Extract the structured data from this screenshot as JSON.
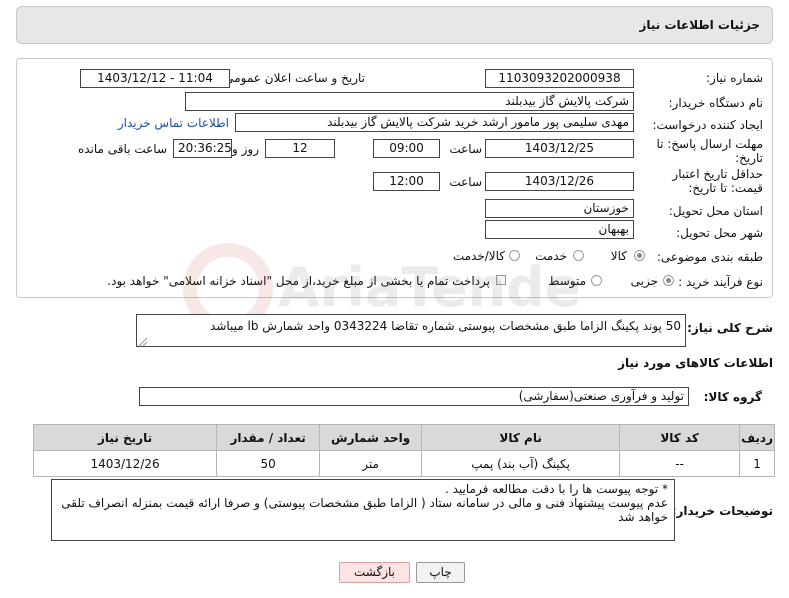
{
  "header": {
    "title": "جزئیات اطلاعات نیاز"
  },
  "form": {
    "need_number_label": "شماره نیاز:",
    "need_number": "1103093202000938",
    "announce_label": "تاریخ و ساعت اعلان عمومی:",
    "announce_value": "1403/12/12 - 11:04",
    "buyer_label": "نام دستگاه خریدار:",
    "buyer_value": "شرکت پالایش گاز بیدبلند",
    "creator_label": "ایجاد کننده درخواست:",
    "creator_value": "مهدی سلیمی پور مامور ارشد خرید شرکت پالایش گاز بیدبلند",
    "contact_link": "اطلاعات تماس خریدار",
    "reply_deadline_label": "مهلت ارسال پاسخ: تا تاریخ:",
    "reply_date": "1403/12/25",
    "time_label": "ساعت",
    "reply_time": "09:00",
    "days_value": "12",
    "days_label": "روز و",
    "remaining_value": "20:36:25",
    "remaining_label": "ساعت باقی مانده",
    "validity_label": "حداقل تاریخ اعتبار قیمت: تا تاریخ:",
    "validity_date": "1403/12/26",
    "validity_time": "12:00",
    "province_label": "استان محل تحویل:",
    "province_value": "خوزستان",
    "city_label": "شهر محل تحویل:",
    "city_value": "بهبهان",
    "category_label": "طبقه بندی موضوعی:",
    "category_options": [
      "کالا",
      "خدمت",
      "کالا/خدمت"
    ],
    "category_selected": "کالا",
    "process_label": "نوع فرآیند خرید :",
    "process_options": [
      "جزیی",
      "متوسط"
    ],
    "process_selected": "جزیی",
    "payment_note": "پرداخت تمام یا بخشی از مبلغ خرید،از محل \"اسناد خزانه اسلامی\" خواهد بود."
  },
  "description": {
    "label": "شرح کلی نیاز:",
    "value": "50 پوند پکینگ الزاما طبق مشخصات پیوستی شماره تقاضا 0343224 واحد شمارش lb میباشد"
  },
  "goods_section": {
    "title": "اطلاعات کالاهای مورد نیاز"
  },
  "goods_group": {
    "label": "گروه کالا:",
    "value": "تولید و فرآوری صنعتی(سفارشی)"
  },
  "table": {
    "headers": [
      "ردیف",
      "کد کالا",
      "نام کالا",
      "واحد شمارش",
      "تعداد / مقدار",
      "تاریخ نیاز"
    ],
    "rows": [
      [
        "1",
        "--",
        "پکینگ (آب بند) پمپ",
        "متر",
        "50",
        "1403/12/26"
      ]
    ]
  },
  "buyer_notes": {
    "label": "توضیحات خریدار:",
    "line1": "* توجه پیوست ها  را با دقت مطالعه فرمایید .",
    "line2": "عدم پیوست پیشنهاد فنی و مالی در سامانه ستاد ( الزاما طبق مشخصات پیوستی)  و صرفا ارائه قیمت بمنزله انصراف تلقی خواهد شد"
  },
  "buttons": {
    "print": "چاپ",
    "back": "بازگشت"
  },
  "watermark": {
    "text": "AriaTender.neT"
  }
}
